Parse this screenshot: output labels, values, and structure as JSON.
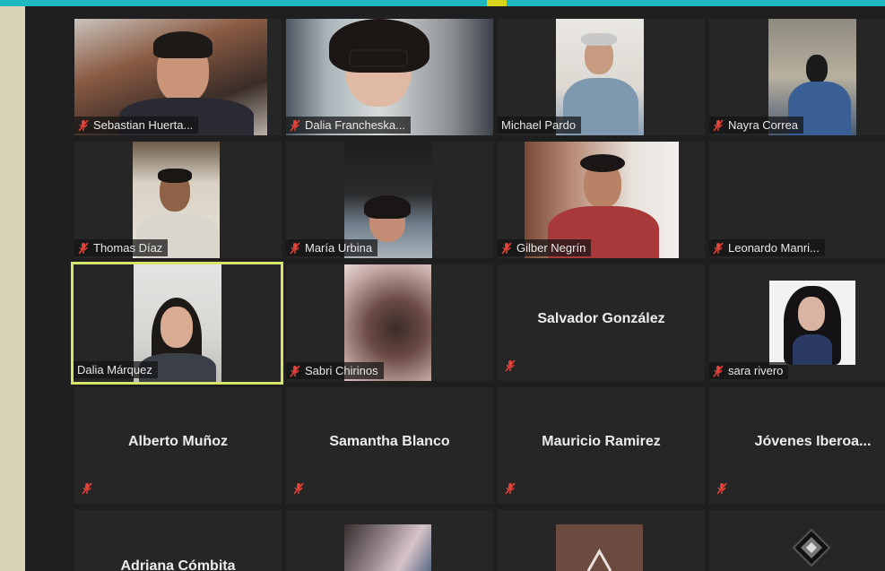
{
  "colors": {
    "accent_bar": "#1db8c0",
    "active_speaker_border": "#d7e46b",
    "tile_background": "#262626",
    "muted_icon": "#e0433a"
  },
  "participants": [
    {
      "name": "Sebastian Huerta...",
      "video": true,
      "muted": true
    },
    {
      "name": "Dalia Francheska...",
      "video": true,
      "muted": true
    },
    {
      "name": "Michael Pardo",
      "video": true,
      "muted": false
    },
    {
      "name": "Nayra Correa",
      "video": true,
      "muted": true
    },
    {
      "name": "Thomas Díaz",
      "video": true,
      "muted": true
    },
    {
      "name": "María Urbina",
      "video": true,
      "muted": true
    },
    {
      "name": "Gilber Negrín",
      "video": true,
      "muted": true
    },
    {
      "name": "Leonardo Manri...",
      "video": false,
      "muted": true
    },
    {
      "name": "Dalia Márquez",
      "video": true,
      "muted": false,
      "active": true
    },
    {
      "name": "Sabri Chirinos",
      "video": true,
      "muted": true
    },
    {
      "name": "Salvador González",
      "video": false,
      "muted": true
    },
    {
      "name": "sara rivero",
      "video": true,
      "muted": true
    },
    {
      "name": "Alberto Muñoz",
      "video": false,
      "muted": true
    },
    {
      "name": "Samantha Blanco",
      "video": false,
      "muted": true
    },
    {
      "name": "Mauricio Ramirez",
      "video": false,
      "muted": true
    },
    {
      "name": "Jóvenes  Iberoa...",
      "video": false,
      "muted": true
    },
    {
      "name": "Adriana Cómbita",
      "video": false,
      "muted": false
    }
  ]
}
